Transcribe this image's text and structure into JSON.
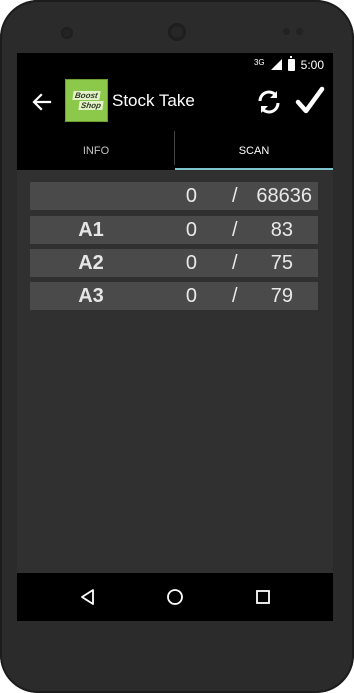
{
  "status": {
    "network": "3G",
    "time": "5:00"
  },
  "appbar": {
    "title": "Stock Take",
    "logo_line1": "Boost",
    "logo_line2": "Shop"
  },
  "tabs": [
    {
      "label": "INFO",
      "active": false
    },
    {
      "label": "SCAN",
      "active": true
    }
  ],
  "rows": [
    {
      "name": "",
      "scanned": "0",
      "sep": "/",
      "total": "68636"
    },
    {
      "name": "A1",
      "scanned": "0",
      "sep": "/",
      "total": "83"
    },
    {
      "name": "A2",
      "scanned": "0",
      "sep": "/",
      "total": "75"
    },
    {
      "name": "A3",
      "scanned": "0",
      "sep": "/",
      "total": "79"
    }
  ],
  "icons": {
    "back": "arrow-left-icon",
    "sync": "sync-icon",
    "confirm": "checkmark-icon",
    "nav_back": "triangle-back-icon",
    "nav_home": "circle-home-icon",
    "nav_recent": "square-recent-icon"
  },
  "colors": {
    "tab_indicator": "#7ec3cb",
    "logo_bg": "#8cc94a",
    "row_bg": "#4a4a4a"
  }
}
